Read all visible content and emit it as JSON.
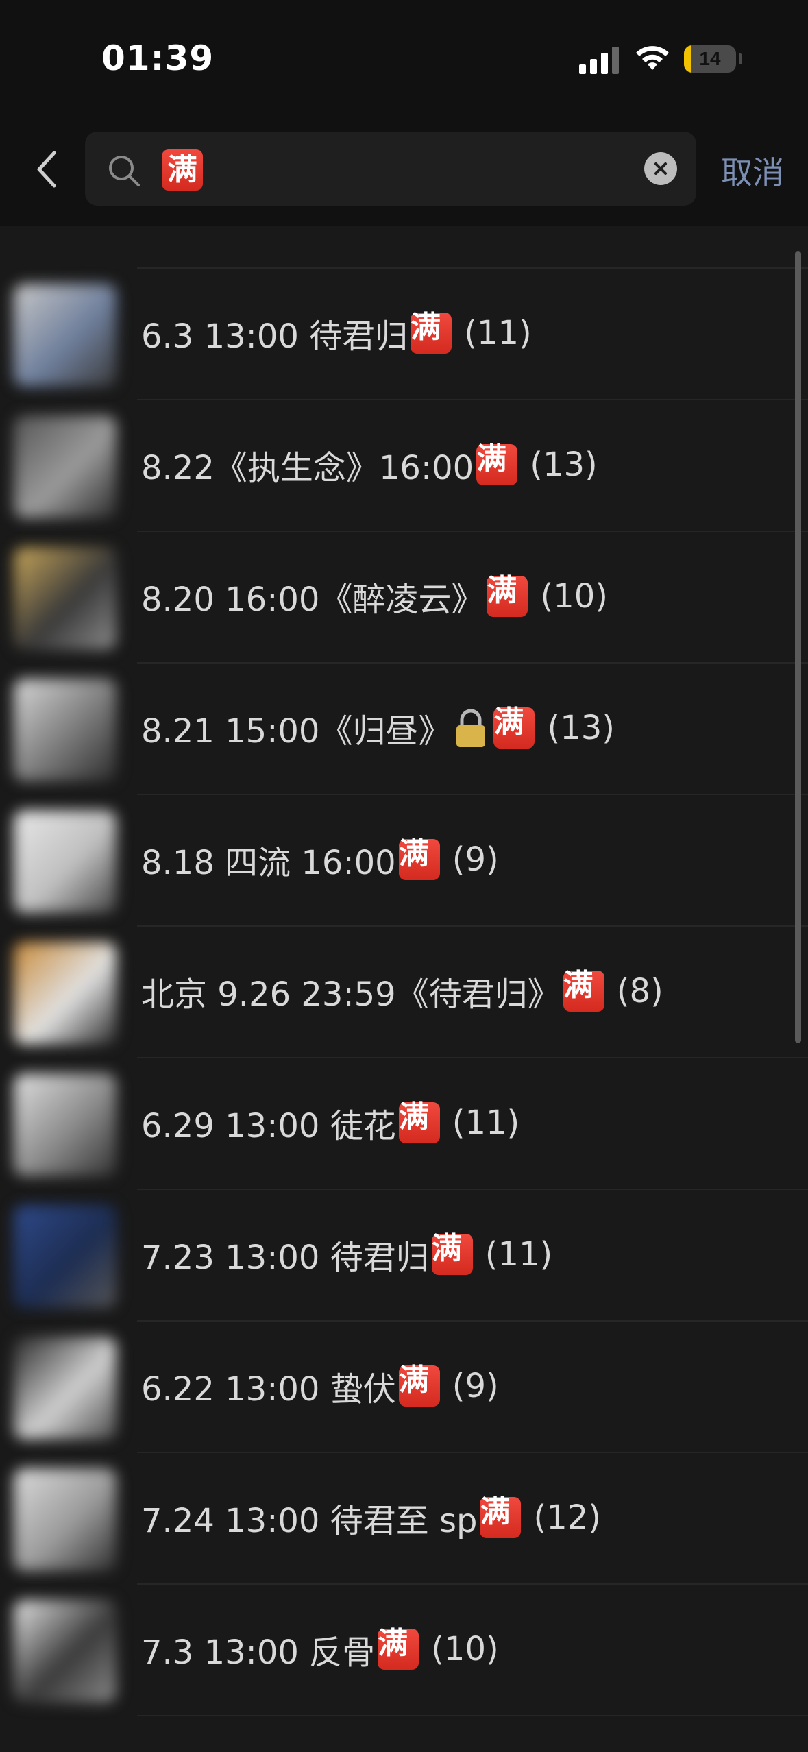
{
  "status_bar": {
    "time": "01:39",
    "battery_level": "14",
    "battery_fraction": 0.14,
    "icons": [
      "signal-icon",
      "wifi-icon",
      "battery-icon"
    ]
  },
  "search": {
    "query": "满",
    "cancel_label": "取消",
    "icons": [
      "back-icon",
      "search-icon",
      "clear-icon"
    ]
  },
  "badge_char": "满",
  "results": [
    {
      "prefix": "6.3 13:00 待君归",
      "lock": false,
      "count": "(11)"
    },
    {
      "prefix": "8.22《执生念》16:00",
      "lock": false,
      "count": "(13)"
    },
    {
      "prefix": "8.20 16:00《醉凌云》",
      "lock": false,
      "count": "(10)"
    },
    {
      "prefix": "8.21 15:00《归昼》",
      "lock": true,
      "count": "(13)"
    },
    {
      "prefix": "8.18 四流 16:00",
      "lock": false,
      "count": "(9)"
    },
    {
      "prefix": "北京 9.26 23:59《待君归》",
      "lock": false,
      "count": "(8)"
    },
    {
      "prefix": "6.29 13:00 徒花",
      "lock": false,
      "count": "(11)"
    },
    {
      "prefix": "7.23 13:00 待君归",
      "lock": false,
      "count": "(11)"
    },
    {
      "prefix": "6.22 13:00 蛰伏",
      "lock": false,
      "count": "(9)"
    },
    {
      "prefix": "7.24 13:00 待君至 sp",
      "lock": false,
      "count": "(12)"
    },
    {
      "prefix": "7.3 13:00 反骨",
      "lock": false,
      "count": "(10)"
    }
  ],
  "colors": {
    "background": "#191919",
    "header": "#111111",
    "badge": "#e23a2f",
    "cancel": "#7d90b4"
  }
}
